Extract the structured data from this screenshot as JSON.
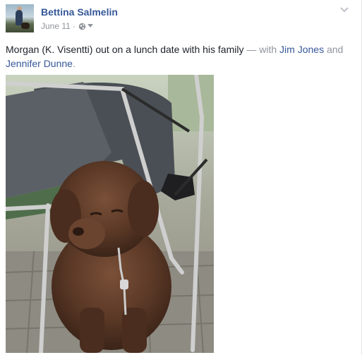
{
  "post": {
    "author": "Bettina Salmelin",
    "date": "June 11",
    "separator": "·",
    "privacy_icon": "globe-icon",
    "caret_icon": "caret-down-icon",
    "menu_icon": "chevron-down-icon",
    "message": "Morgan (K. Visentti) out on a lunch date with his family",
    "with_prefix": " — with ",
    "tagged": [
      "Jim Jones",
      "Jennifer Dunne"
    ],
    "tag_joiner": " and ",
    "tag_end": ".",
    "photo_subject": "brown newfoundland puppy"
  },
  "colors": {
    "link": "#365899",
    "text": "#1d2129",
    "meta": "#90949c"
  }
}
